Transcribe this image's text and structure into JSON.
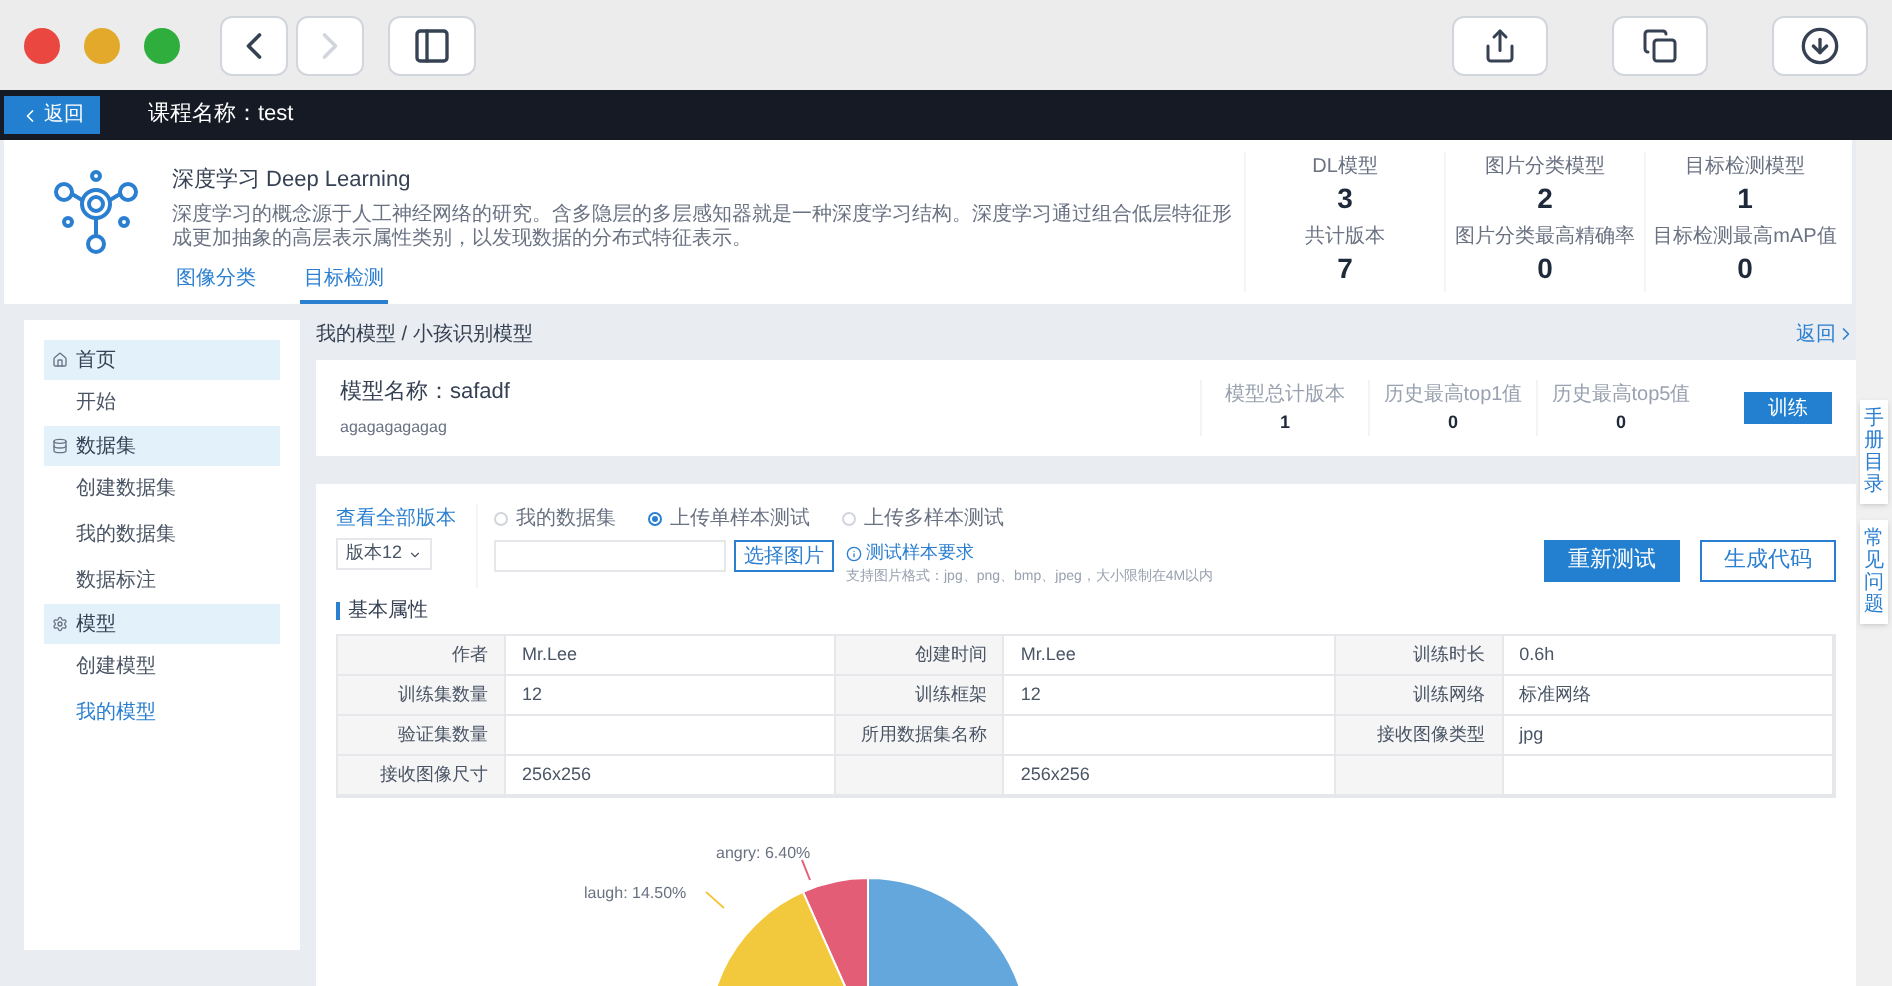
{
  "toolbar": {
    "back": {
      "disabled": false
    },
    "forward": {
      "disabled": true
    }
  },
  "topbar": {
    "back_button": "返回",
    "course_label": "课程名称：test"
  },
  "course": {
    "title": "深度学习 Deep Learning",
    "description": "深度学习的概念源于人工神经网络的研究。含多隐层的多层感知器就是一种深度学习结构。深度学习通过组合低层特征形成更加抽象的高层表示属性类别，以发现数据的分布式特征表示。",
    "tabs": [
      {
        "label": "图像分类",
        "selected": false
      },
      {
        "label": "目标检测",
        "selected": true
      }
    ],
    "stats": [
      {
        "label": "DL模型",
        "value": "3"
      },
      {
        "label": "图片分类模型",
        "value": "2"
      },
      {
        "label": "目标检测模型",
        "value": "1"
      },
      {
        "label": "共计版本",
        "value": "7"
      },
      {
        "label": "图片分类最高精确率",
        "value": "0"
      },
      {
        "label": "目标检测最高mAP值",
        "value": "0"
      }
    ]
  },
  "sidebar": {
    "items": [
      {
        "label": "首页",
        "kind": "group",
        "selected": false
      },
      {
        "label": "开始",
        "kind": "link",
        "selected": false
      },
      {
        "label": "数据集",
        "kind": "group",
        "selected": false
      },
      {
        "label": "创建数据集",
        "kind": "link",
        "selected": false
      },
      {
        "label": "我的数据集",
        "kind": "link",
        "selected": false
      },
      {
        "label": "数据标注",
        "kind": "link",
        "selected": false
      },
      {
        "label": "模型",
        "kind": "group",
        "selected": false
      },
      {
        "label": "创建模型",
        "kind": "link",
        "selected": false
      },
      {
        "label": "我的模型",
        "kind": "link",
        "selected": true
      }
    ]
  },
  "breadcrumb": "我的模型 / 小孩识别模型",
  "return_link": "返回",
  "model": {
    "name": "模型名称：safadf",
    "description": "agagagagagag",
    "stats": [
      {
        "label": "模型总计版本",
        "value": "1"
      },
      {
        "label": "历史最高top1值",
        "value": "0"
      },
      {
        "label": "历史最高top5值",
        "value": "0"
      }
    ],
    "train_button": "训练"
  },
  "test": {
    "versions_link": "查看全部版本",
    "version_select": "版本12",
    "sources": [
      {
        "label": "我的数据集",
        "selected": false
      },
      {
        "label": "上传单样本测试",
        "selected": true
      },
      {
        "label": "上传多样本测试",
        "selected": false
      }
    ],
    "choose_button": "选择图片",
    "requirements_link": "测试样本要求",
    "formats": "支持图片格式：jpg、png、bmp、jpeg，大小限制在4M以内",
    "retest_button": "重新测试",
    "codegen_button": "生成代码"
  },
  "attributes": {
    "title": "基本属性",
    "rows": [
      [
        {
          "label": "作者",
          "value": "Mr.Lee"
        },
        {
          "label": "创建时间",
          "value": "Mr.Lee"
        },
        {
          "label": "训练时长",
          "value": "0.6h"
        }
      ],
      [
        {
          "label": "训练集数量",
          "value": "12"
        },
        {
          "label": "训练框架",
          "value": "12"
        },
        {
          "label": "训练网络",
          "value": "标准网络"
        }
      ],
      [
        {
          "label": "验证集数量"
        },
        {
          "label": "所用数据集名称"
        },
        {
          "label": "接收图像类型",
          "value": "jpg"
        }
      ],
      [
        {
          "label": "接收图像尺寸",
          "value": "256x256"
        },
        {
          "value": "256x256"
        },
        {}
      ]
    ]
  },
  "pie": {
    "labels": [
      {
        "text": "angry: 6.40%",
        "color": "#e35d76"
      },
      {
        "text": "laugh: 14.50%",
        "color": "#f2c93c"
      }
    ]
  },
  "side_tabs": [
    "手册目录",
    "常见问题"
  ]
}
